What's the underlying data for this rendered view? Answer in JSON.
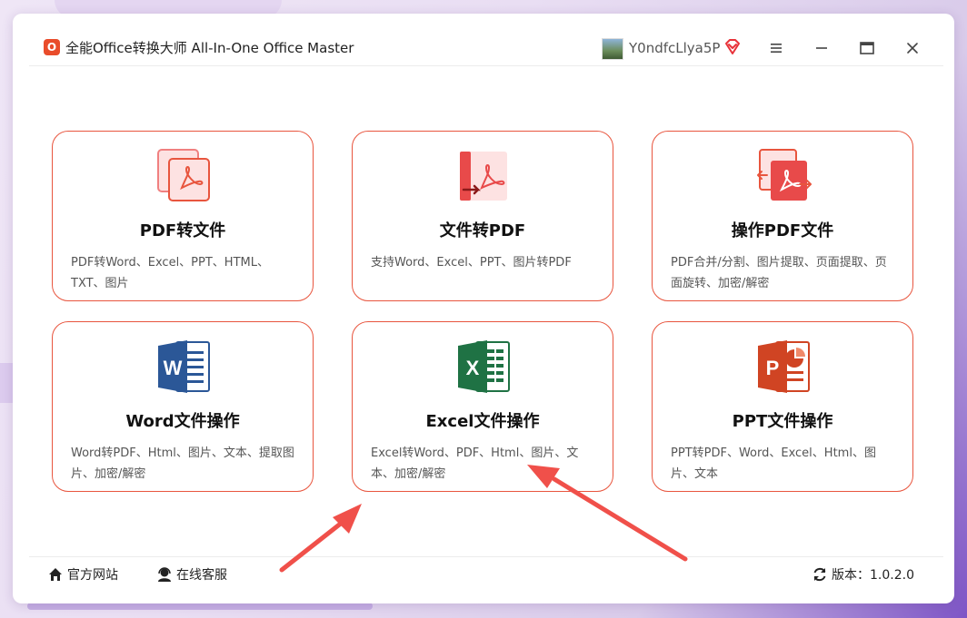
{
  "window": {
    "title": "全能Office转换大师 All-In-One Office Master",
    "logo_text": "O",
    "username": "Y0ndfcLlya5P"
  },
  "cards": [
    {
      "title": "PDF转文件",
      "desc": "PDF转Word、Excel、PPT、HTML、TXT、图片",
      "icon": "pdf-to-file-icon"
    },
    {
      "title": "文件转PDF",
      "desc": "支持Word、Excel、PPT、图片转PDF",
      "icon": "file-to-pdf-icon"
    },
    {
      "title": "操作PDF文件",
      "desc": "PDF合并/分割、图片提取、页面提取、页面旋转、加密/解密",
      "icon": "operate-pdf-icon"
    },
    {
      "title": "Word文件操作",
      "desc": "Word转PDF、Html、图片、文本、提取图片、加密/解密",
      "icon": "word-icon"
    },
    {
      "title": "Excel文件操作",
      "desc": "Excel转Word、PDF、Html、图片、文本、加密/解密",
      "icon": "excel-icon"
    },
    {
      "title": "PPT文件操作",
      "desc": "PPT转PDF、Word、Excel、Html、图片、文本",
      "icon": "ppt-icon"
    }
  ],
  "footer": {
    "website": "官方网站",
    "support": "在线客服",
    "version": "版本：1.0.2.0"
  },
  "colors": {
    "accent": "#e8553e",
    "word": "#2b5797",
    "excel": "#1f7244",
    "ppt": "#d04423",
    "annotation_arrow": "#f0504a"
  }
}
